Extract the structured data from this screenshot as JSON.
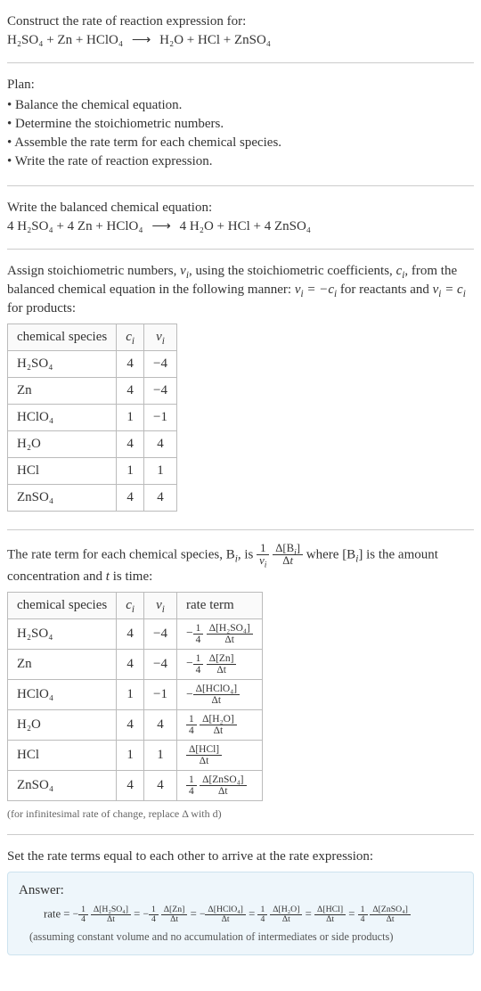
{
  "intro": {
    "line1": "Construct the rate of reaction expression for:",
    "eq_lhs": "H₂SO₄ + Zn + HClO₄",
    "arrow": "⟶",
    "eq_rhs": "H₂O + HCl + ZnSO₄"
  },
  "plan": {
    "heading": "Plan:",
    "items": [
      "Balance the chemical equation.",
      "Determine the stoichiometric numbers.",
      "Assemble the rate term for each chemical species.",
      "Write the rate of reaction expression."
    ]
  },
  "balanced": {
    "heading": "Write the balanced chemical equation:",
    "eq_lhs": "4 H₂SO₄ + 4 Zn + HClO₄",
    "arrow": "⟶",
    "eq_rhs": "4 H₂O + HCl + 4 ZnSO₄"
  },
  "assign": {
    "text_a": "Assign stoichiometric numbers, ",
    "nu_i": "ν_i",
    "text_b": ", using the stoichiometric coefficients, ",
    "c_i": "c_i",
    "text_c": ", from the balanced chemical equation in the following manner: ",
    "rel_react": "ν_i = −c_i",
    "text_d": " for reactants and ",
    "rel_prod": "ν_i = c_i",
    "text_e": " for products:"
  },
  "table1": {
    "headers": [
      "chemical species",
      "c_i",
      "ν_i"
    ],
    "rows": [
      {
        "sp": "H₂SO₄",
        "c": "4",
        "v": "−4"
      },
      {
        "sp": "Zn",
        "c": "4",
        "v": "−4"
      },
      {
        "sp": "HClO₄",
        "c": "1",
        "v": "−1"
      },
      {
        "sp": "H₂O",
        "c": "4",
        "v": "4"
      },
      {
        "sp": "HCl",
        "c": "1",
        "v": "1"
      },
      {
        "sp": "ZnSO₄",
        "c": "4",
        "v": "4"
      }
    ]
  },
  "rateterm_intro": {
    "a": "The rate term for each chemical species, B",
    "b": ", is ",
    "one": "1",
    "nu": "ν_i",
    "dB_num": "Δ[B_i]",
    "dB_den": "Δt",
    "c": " where [B",
    "d": "] is the amount concentration and ",
    "t": "t",
    "e": " is time:"
  },
  "table2": {
    "headers": [
      "chemical species",
      "c_i",
      "ν_i",
      "rate term"
    ],
    "rows": [
      {
        "sp": "H₂SO₄",
        "c": "4",
        "v": "−4",
        "sign": "−",
        "coef_num": "1",
        "coef_den": "4",
        "d_num": "Δ[H₂SO₄]",
        "d_den": "Δt"
      },
      {
        "sp": "Zn",
        "c": "4",
        "v": "−4",
        "sign": "−",
        "coef_num": "1",
        "coef_den": "4",
        "d_num": "Δ[Zn]",
        "d_den": "Δt"
      },
      {
        "sp": "HClO₄",
        "c": "1",
        "v": "−1",
        "sign": "−",
        "coef_num": "",
        "coef_den": "",
        "d_num": "Δ[HClO₄]",
        "d_den": "Δt"
      },
      {
        "sp": "H₂O",
        "c": "4",
        "v": "4",
        "sign": "",
        "coef_num": "1",
        "coef_den": "4",
        "d_num": "Δ[H₂O]",
        "d_den": "Δt"
      },
      {
        "sp": "HCl",
        "c": "1",
        "v": "1",
        "sign": "",
        "coef_num": "",
        "coef_den": "",
        "d_num": "Δ[HCl]",
        "d_den": "Δt"
      },
      {
        "sp": "ZnSO₄",
        "c": "4",
        "v": "4",
        "sign": "",
        "coef_num": "1",
        "coef_den": "4",
        "d_num": "Δ[ZnSO₄]",
        "d_den": "Δt"
      }
    ],
    "footnote": "(for infinitesimal rate of change, replace Δ with d)"
  },
  "setequal": "Set the rate terms equal to each other to arrive at the rate expression:",
  "answer": {
    "heading": "Answer:",
    "prefix": "rate = ",
    "terms": [
      {
        "sign": "−",
        "coef_num": "1",
        "coef_den": "4",
        "d_num": "Δ[H₂SO₄]",
        "d_den": "Δt"
      },
      {
        "sign": "−",
        "coef_num": "1",
        "coef_den": "4",
        "d_num": "Δ[Zn]",
        "d_den": "Δt"
      },
      {
        "sign": "−",
        "coef_num": "",
        "coef_den": "",
        "d_num": "Δ[HClO₄]",
        "d_den": "Δt"
      },
      {
        "sign": "",
        "coef_num": "1",
        "coef_den": "4",
        "d_num": "Δ[H₂O]",
        "d_den": "Δt"
      },
      {
        "sign": "",
        "coef_num": "",
        "coef_den": "",
        "d_num": "Δ[HCl]",
        "d_den": "Δt"
      },
      {
        "sign": "",
        "coef_num": "1",
        "coef_den": "4",
        "d_num": "Δ[ZnSO₄]",
        "d_den": "Δt"
      }
    ],
    "eq": " = ",
    "note": "(assuming constant volume and no accumulation of intermediates or side products)"
  }
}
